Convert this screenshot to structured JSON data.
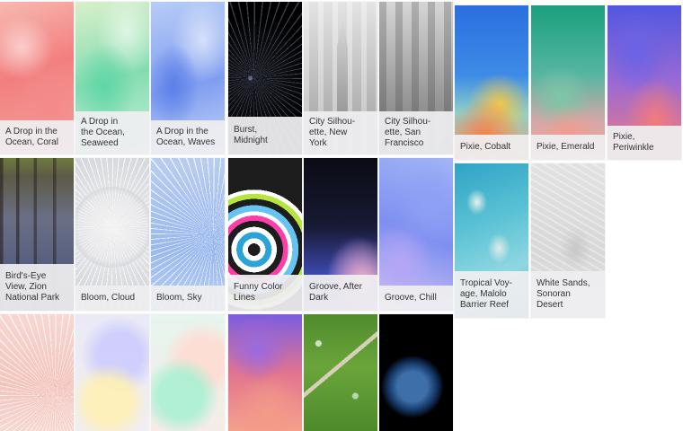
{
  "wallpapers": [
    {
      "id": "coral",
      "caption": [
        "A Drop in the",
        "Ocean, Coral"
      ]
    },
    {
      "id": "seaweed",
      "caption": [
        "A Drop in",
        "the Ocean,",
        "Seaweed"
      ]
    },
    {
      "id": "waves",
      "caption": [
        "A Drop in the",
        "Ocean, Waves"
      ]
    },
    {
      "id": "burst",
      "caption": [
        "Burst,",
        "Midnight"
      ]
    },
    {
      "id": "ny",
      "caption": [
        "City Silhou-",
        "ette, New",
        "York"
      ]
    },
    {
      "id": "sf",
      "caption": [
        "City Silhou-",
        "ette, San",
        "Francisco"
      ]
    },
    {
      "id": "cobalt",
      "caption": [
        "Pixie, Cobalt"
      ]
    },
    {
      "id": "emerald",
      "caption": [
        "Pixie, Emerald"
      ]
    },
    {
      "id": "periwinkle",
      "caption": [
        "Pixie,",
        "Periwinkle"
      ]
    },
    {
      "id": "zion",
      "caption": [
        "Bird's-Eye",
        "View, Zion",
        "National Park"
      ]
    },
    {
      "id": "cloud",
      "caption": [
        "Bloom, Cloud"
      ]
    },
    {
      "id": "sky",
      "caption": [
        "Bloom, Sky"
      ]
    },
    {
      "id": "funny",
      "caption": [
        "Funny Color",
        "Lines"
      ]
    },
    {
      "id": "groove-dark",
      "caption": [
        "Groove, After",
        "Dark"
      ]
    },
    {
      "id": "groove-chill",
      "caption": [
        "Groove, Chill"
      ]
    },
    {
      "id": "reef",
      "caption": [
        "Tropical Voy-",
        "age, Malolo",
        "Barrier Reef"
      ]
    },
    {
      "id": "sands",
      "caption": [
        "White Sands,",
        "Sonoran",
        "Desert"
      ]
    }
  ]
}
